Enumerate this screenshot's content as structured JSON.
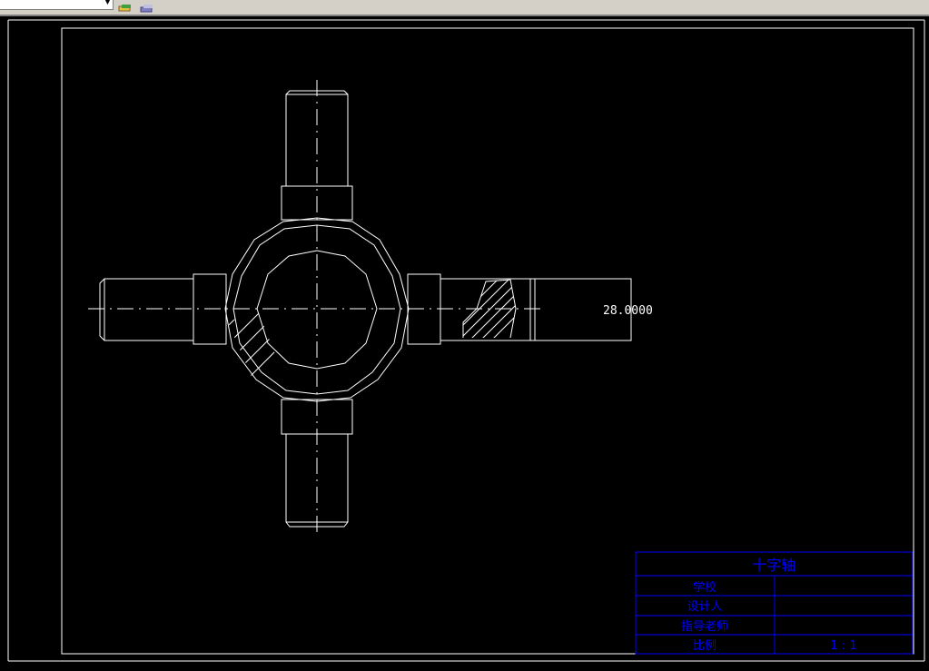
{
  "app": {
    "layer_combo_value": "",
    "toolbar_icons": [
      "layer-properties-icon",
      "layer-states-icon"
    ]
  },
  "drawing": {
    "dimension_text": "28.0000",
    "colors": {
      "background": "#000000",
      "geometry": "#ffffff",
      "title_block": "#0000ff"
    }
  },
  "title_block": {
    "title": "十字轴",
    "rows": [
      {
        "label": "学校",
        "value": ""
      },
      {
        "label": "设计人",
        "value": ""
      },
      {
        "label": "指导老师",
        "value": ""
      },
      {
        "label": "比例",
        "value": "1 : 1"
      }
    ]
  }
}
